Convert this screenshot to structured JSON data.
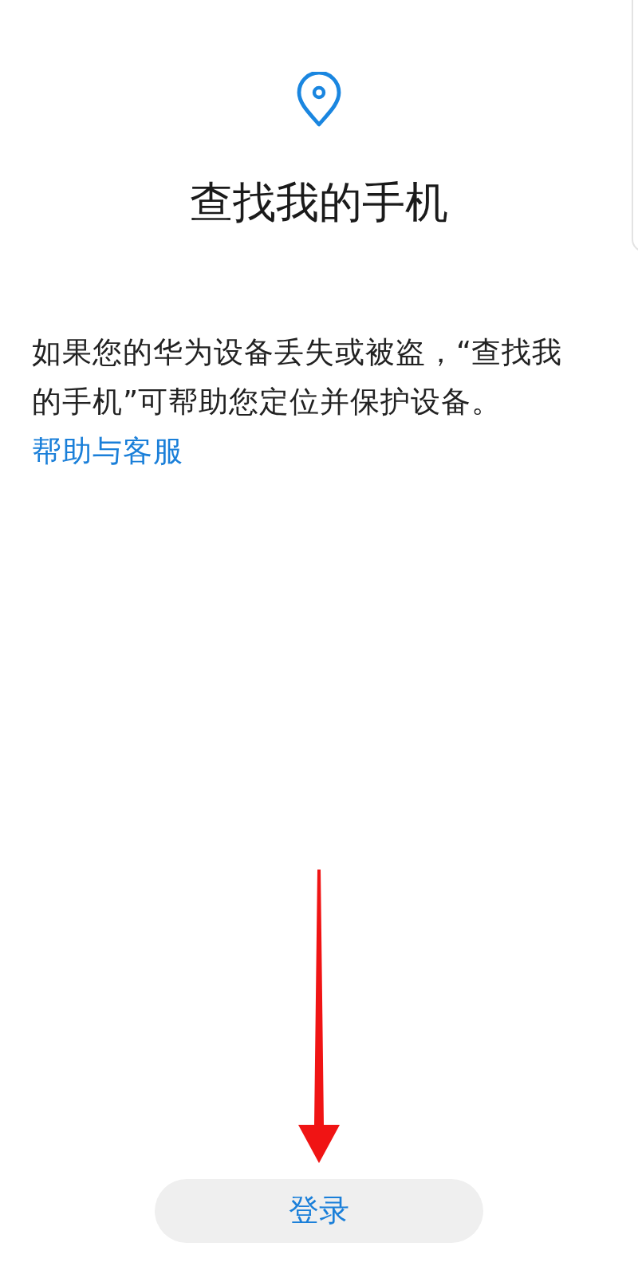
{
  "title": "查找我的手机",
  "description": {
    "text": "如果您的华为设备丢失或被盗，“查找我的手机”可帮助您定位并保护设备。",
    "link": "帮助与客服"
  },
  "login_button": {
    "label": "登录"
  }
}
